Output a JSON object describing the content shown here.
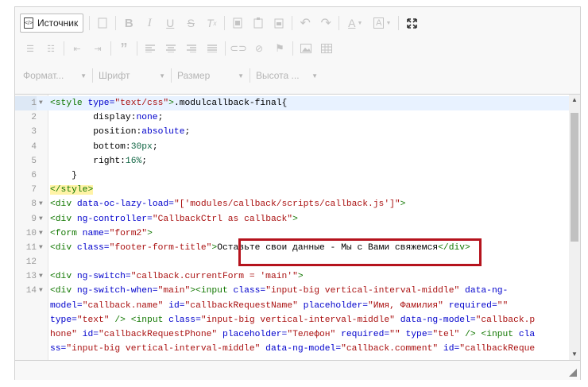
{
  "toolbar": {
    "source_label": "Источник",
    "combos": [
      {
        "label": "Формат..."
      },
      {
        "label": "Шрифт"
      },
      {
        "label": "Размер"
      },
      {
        "label": "Высота ..."
      }
    ]
  },
  "code_lines": [
    {
      "n": "1",
      "fold": true
    },
    {
      "n": "2",
      "fold": false
    },
    {
      "n": "3",
      "fold": false
    },
    {
      "n": "4",
      "fold": false
    },
    {
      "n": "5",
      "fold": false
    },
    {
      "n": "6",
      "fold": false
    },
    {
      "n": "7",
      "fold": false
    },
    {
      "n": "8",
      "fold": true
    },
    {
      "n": "9",
      "fold": true
    },
    {
      "n": "10",
      "fold": true
    },
    {
      "n": "11",
      "fold": true
    },
    {
      "n": "12",
      "fold": false
    },
    {
      "n": "13",
      "fold": true
    },
    {
      "n": "14",
      "fold": true
    }
  ],
  "code": {
    "l1_tag": "<style",
    "l1_attr": " type=",
    "l1_str": "\"text/css\"",
    "l1_tag2": ">",
    "l1_rest": ".modulcallback-final{",
    "l2": "        display:none;",
    "l2_a": "        display:",
    "l2_b": "none",
    "l2_c": ";",
    "l3_a": "        position:",
    "l3_b": "absolute",
    "l3_c": ";",
    "l4_a": "        bottom:",
    "l4_b": "30px",
    "l4_c": ";",
    "l5_a": "        right:",
    "l5_b": "16%",
    "l5_c": ";",
    "l6": "    }",
    "l7": "</style>",
    "l8_tag": "<div",
    "l8_attr": " data-oc-lazy-load=",
    "l8_str": "\"['modules/callback/scripts/callback.js']\"",
    "l8_end": ">",
    "l9_tag": "<div",
    "l9_attr": " ng-controller=",
    "l9_str": "\"CallbackCtrl as callback\"",
    "l9_end": ">",
    "l10_tag": "<form",
    "l10_attr": " name=",
    "l10_str": "\"form2\"",
    "l10_end": ">",
    "l11_tag": "<div",
    "l11_attr": " class=",
    "l11_str": "\"footer-form-title\"",
    "l11_end": ">",
    "l11_text": "Оставьте свои данные - Мы с Вами свяжемся",
    "l11_close": "</div>",
    "l13_tag": "<div",
    "l13_attr": " ng-switch=",
    "l13_str": "\"callback.currentForm = 'main'\"",
    "l13_end": ">",
    "l14_tag": "<div",
    "l14_attr": " ng-switch-when=",
    "l14_str": "\"main\"",
    "l14_tag2": "><input",
    "l14_attr2": " class=",
    "l14_str2": "\"input-big vertical-interval-middle\"",
    "l14_attr3": " data-ng-",
    "w2_attr": "model=",
    "w2_str": "\"callback.name\"",
    "w2_attr2": " id=",
    "w2_str2": "\"callbackRequestName\"",
    "w2_attr3": " placeholder=",
    "w2_str3": "\"Имя, Фамилия\"",
    "w2_attr4": " required=",
    "w2_str4": "\"\"",
    "w3_attr": "type=",
    "w3_str": "\"text\"",
    "w3_tag": " /> <input",
    "w3_attr2": " class=",
    "w3_str2": "\"input-big vertical-interval-middle\"",
    "w3_attr3": " data-ng-model=",
    "w3_str3": "\"callback.p",
    "w4_str": "hone\"",
    "w4_attr": " id=",
    "w4_str2": "\"callbackRequestPhone\"",
    "w4_attr2": " placeholder=",
    "w4_str3": "\"Телефон\"",
    "w4_attr3": " required=",
    "w4_str4": "\"\"",
    "w4_attr4": " type=",
    "w4_str5": "\"tel\"",
    "w4_tag": " /> <input",
    "w4_attr5": " cla",
    "w5_attr": "ss=",
    "w5_str": "\"input-big vertical-interval-middle\"",
    "w5_attr2": " data-ng-model=",
    "w5_str2": "\"callback.comment\"",
    "w5_attr3": " id=",
    "w5_str3": "\"callbackReque"
  },
  "colors": {
    "highlight_border": "#b5131d",
    "tag": "#117700",
    "attr": "#0000cc",
    "string": "#aa1111"
  }
}
